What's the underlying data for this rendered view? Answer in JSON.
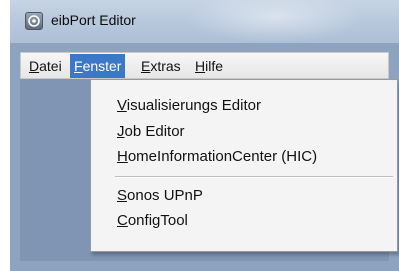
{
  "window": {
    "title": "eibPort Editor",
    "app_icon": "eibport-app-icon"
  },
  "menubar": {
    "items": [
      {
        "mnemonic": "D",
        "rest": "atei"
      },
      {
        "mnemonic": "F",
        "rest": "enster"
      },
      {
        "mnemonic": "E",
        "rest": "xtras"
      },
      {
        "mnemonic": "H",
        "rest": "ilfe"
      }
    ],
    "active_item": "Fenster"
  },
  "dropdown": {
    "items": [
      {
        "mnemonic": "V",
        "rest": "isualisierungs Editor"
      },
      {
        "mnemonic": "J",
        "rest": "ob Editor"
      },
      {
        "mnemonic": "H",
        "rest": "omeInformationCenter (HIC)"
      },
      {
        "mnemonic": "S",
        "rest": "onos UPnP"
      },
      {
        "mnemonic": "C",
        "rest": "onfigTool"
      }
    ]
  },
  "colors": {
    "menu_highlight": "#3b78c7",
    "background": "#8094b4"
  }
}
